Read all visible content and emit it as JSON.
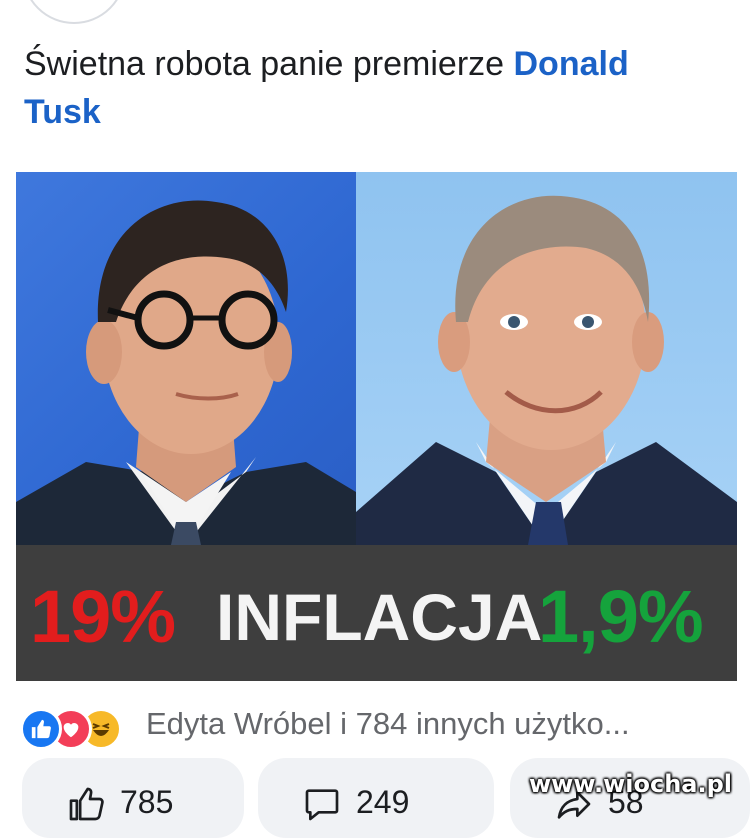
{
  "post": {
    "text_prefix": "Świetna robota panie premierze ",
    "mention": "Donald Tusk"
  },
  "image": {
    "caption_left": "19%",
    "caption_mid": "INFLACJA",
    "caption_right": "1,9%",
    "colors": {
      "left": "#e21d1d",
      "mid": "#f4f4f4",
      "right": "#15a33c",
      "band": "#3e3e3e"
    }
  },
  "reactions": {
    "icons": [
      "like-icon",
      "love-icon",
      "haha-icon"
    ],
    "summary": "Edyta Wróbel i 784 innych użytko..."
  },
  "actions": {
    "like_count": "785",
    "comment_count": "249",
    "share_count": "58"
  },
  "watermark": "www.wiocha.pl"
}
